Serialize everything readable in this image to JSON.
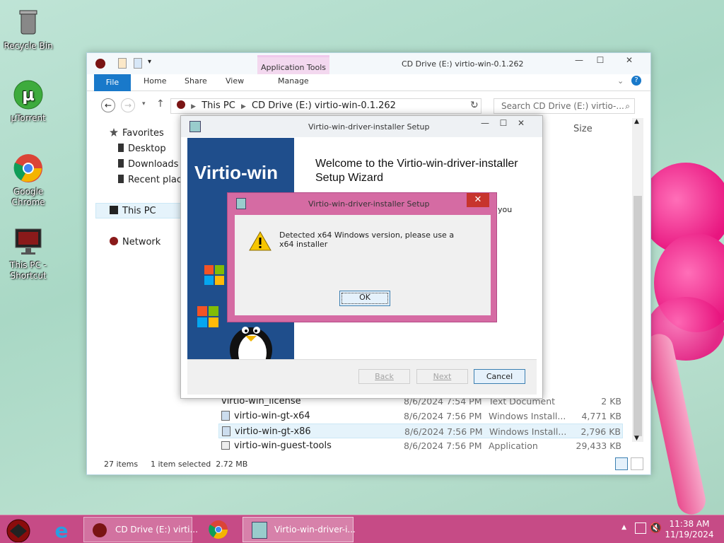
{
  "desktop": {
    "icons": [
      {
        "name": "recycle-bin",
        "label": "Recycle Bin"
      },
      {
        "name": "utorrent",
        "label": "µTorrent"
      },
      {
        "name": "google-chrome",
        "label": "Google Chrome"
      },
      {
        "name": "this-pc-shortcut",
        "label": "This PC - Shortcut"
      }
    ]
  },
  "explorer": {
    "title": "CD Drive (E:) virtio-win-0.1.262",
    "app_tools": "Application Tools",
    "tabs": {
      "file": "File",
      "home": "Home",
      "share": "Share",
      "view": "View",
      "manage": "Manage"
    },
    "address": {
      "root": "This PC",
      "path": "CD Drive (E:) virtio-win-0.1.262"
    },
    "search_placeholder": "Search CD Drive (E:) virtio-...",
    "column_size": "Size",
    "nav": {
      "favorites": "Favorites",
      "desktop": "Desktop",
      "downloads": "Downloads",
      "recent": "Recent plac",
      "this_pc": "This PC",
      "network": "Network"
    },
    "files": [
      {
        "name": "virtio-win_license",
        "date": "8/6/2024 7:54 PM",
        "type": "Text Document",
        "size": "2 KB"
      },
      {
        "name": "virtio-win-gt-x64",
        "date": "8/6/2024 7:56 PM",
        "type": "Windows Install...",
        "size": "4,771 KB"
      },
      {
        "name": "virtio-win-gt-x86",
        "date": "8/6/2024 7:56 PM",
        "type": "Windows Install...",
        "size": "2,796 KB"
      },
      {
        "name": "virtio-win-guest-tools",
        "date": "8/6/2024 7:56 PM",
        "type": "Application",
        "size": "29,433 KB"
      }
    ],
    "status": {
      "count": "27 items",
      "selection": "1 item selected  2.72 MB"
    }
  },
  "wizard": {
    "title": "Virtio-win-driver-installer Setup",
    "brand": "Virtio-win",
    "heading": "Welcome to the Virtio-win-driver-installer Setup Wizard",
    "partial_text": "you",
    "buttons": {
      "back": "Back",
      "next": "Next",
      "cancel": "Cancel"
    }
  },
  "dialog": {
    "title": "Virtio-win-driver-installer Setup",
    "message": "Detected x64 Windows version, please use a x64 installer",
    "ok": "OK",
    "close": "✕"
  },
  "taskbar": {
    "explorer_label": "CD Drive (E:) virti...",
    "setup_label": "Virtio-win-driver-i...",
    "time": "11:38 AM",
    "date": "11/19/2024"
  },
  "colors": {
    "accent_taskbar": "#c64b86",
    "dialog_frame": "#d56ba3",
    "file_tab": "#1979ca",
    "wizard_banner": "#1f4e8c"
  }
}
